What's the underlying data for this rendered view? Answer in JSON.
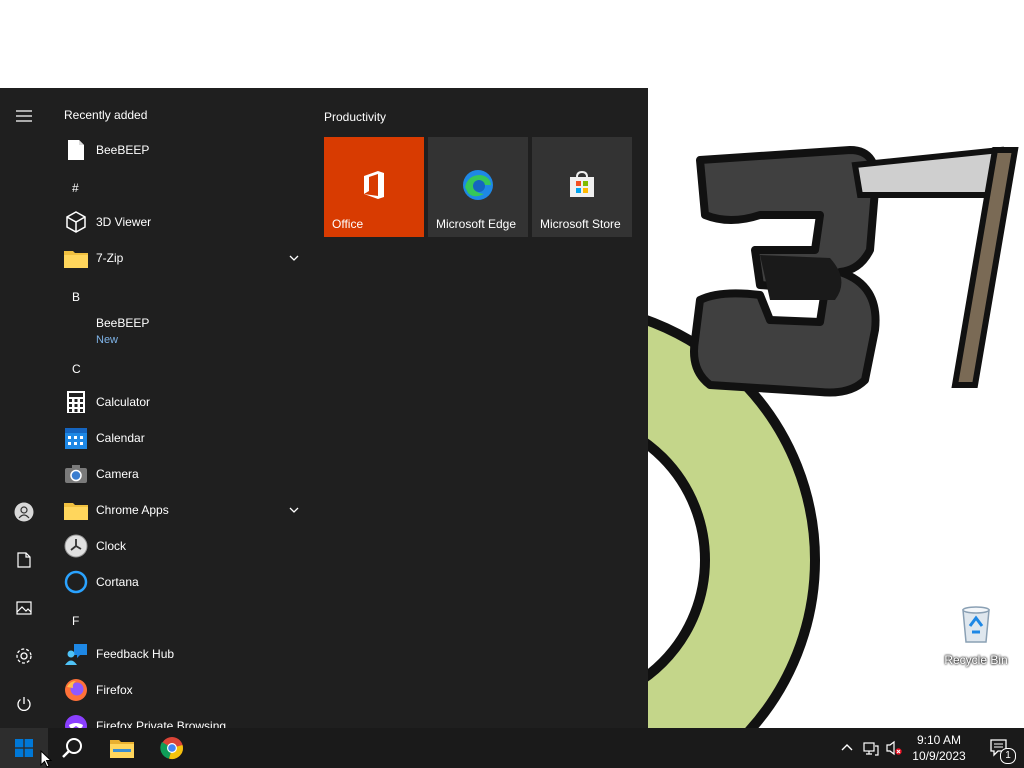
{
  "desktop": {
    "recycle_bin_label": "Recycle Bin"
  },
  "start_menu": {
    "rail": {
      "icons": [
        "hamburger-icon",
        "user-icon",
        "documents-icon",
        "pictures-icon",
        "settings-icon",
        "power-icon"
      ]
    },
    "app_list": {
      "recently_added_header": "Recently added",
      "items": [
        {
          "label": "BeeBEEP",
          "icon": "document-icon"
        },
        {
          "letter": "#"
        },
        {
          "label": "3D Viewer",
          "icon": "cube-icon"
        },
        {
          "label": "7-Zip",
          "icon": "folder-icon",
          "expandable": true
        },
        {
          "letter": "B"
        },
        {
          "label": "BeeBEEP",
          "sub": "New"
        },
        {
          "letter": "C"
        },
        {
          "label": "Calculator",
          "icon": "calculator-icon"
        },
        {
          "label": "Calendar",
          "icon": "calendar-icon"
        },
        {
          "label": "Camera",
          "icon": "camera-icon"
        },
        {
          "label": "Chrome Apps",
          "icon": "folder-icon",
          "expandable": true
        },
        {
          "label": "Clock",
          "icon": "clock-icon"
        },
        {
          "label": "Cortana",
          "icon": "cortana-icon"
        },
        {
          "letter": "F"
        },
        {
          "label": "Feedback Hub",
          "icon": "feedback-icon"
        },
        {
          "label": "Firefox",
          "icon": "firefox-icon"
        },
        {
          "label": "Firefox Private Browsing",
          "icon": "firefox-private-icon"
        }
      ]
    },
    "tiles": {
      "group_title": "Productivity",
      "items": [
        {
          "label": "Office",
          "color": "#d83b01"
        },
        {
          "label": "Microsoft Edge",
          "color": "#333333"
        },
        {
          "label": "Microsoft Store",
          "color": "#333333"
        }
      ]
    }
  },
  "taskbar": {
    "buttons": [
      "start-button",
      "search-button",
      "file-explorer-button",
      "chrome-button"
    ],
    "clock": {
      "time": "9:10 AM",
      "date": "10/9/2023"
    },
    "notification_count": "1"
  },
  "colors": {
    "menu_bg": "#1f1f1f",
    "taskbar_bg": "#1a1a1a",
    "accent_blue": "#0078d7",
    "office_orange": "#d83b01"
  }
}
